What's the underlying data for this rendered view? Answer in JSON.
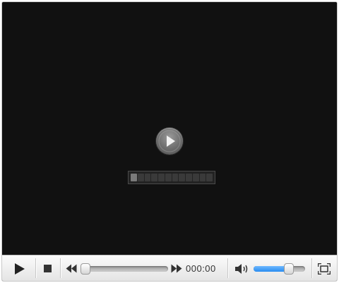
{
  "screen": {
    "buffer": {
      "segments": 12,
      "filled_segments": 1
    }
  },
  "controls": {
    "play_icon": "play-icon",
    "stop_icon": "stop-icon",
    "rewind_icon": "rewind-icon",
    "forward_icon": "fast-forward-icon",
    "time": "000:00",
    "seek_position": 0.0,
    "volume_icon": "volume-icon",
    "volume_level": 0.68,
    "fullscreen_icon": "fullscreen-icon"
  },
  "colors": {
    "screen_bg": "#111111",
    "volume_accent": "#2a8df0"
  }
}
